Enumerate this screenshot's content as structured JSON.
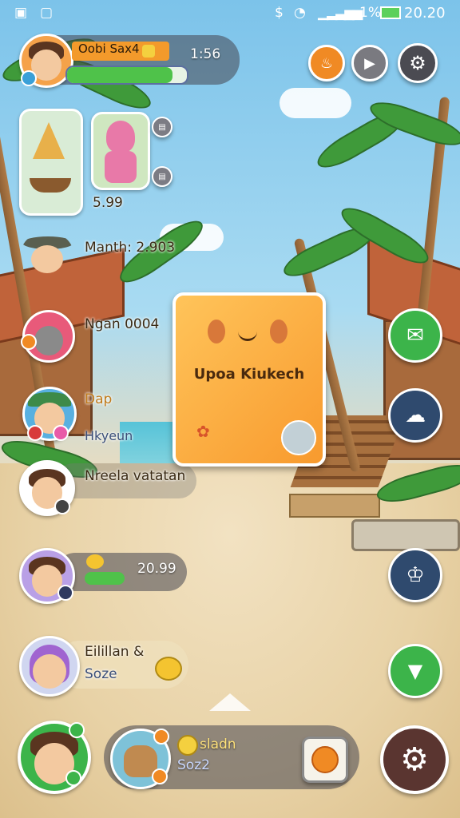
{
  "status_bar": {
    "time": "20.20",
    "battery": "1%"
  },
  "player": {
    "name": "Oobi Sax4",
    "timer": "1:56"
  },
  "side_list": {
    "item_value": "5.99",
    "entries": [
      {
        "label": "Manth: 2.903"
      },
      {
        "label": "Ngan 0004"
      },
      {
        "label": "Dap",
        "sublabel": "Hkyeun"
      },
      {
        "label": "Nreela vatatan"
      },
      {
        "value": "20.99"
      },
      {
        "label": "Eilillan &",
        "sublabel": "Soze"
      }
    ]
  },
  "center_card": {
    "title": "Upoa Kiukech"
  },
  "bottom_bar": {
    "label": "sladn",
    "sublabel": "Soz2"
  },
  "colors": {
    "accent_orange": "#f89a2e",
    "progress_green": "#4fc24a",
    "button_green": "#3cb44a",
    "button_navy": "#2f4a6e"
  },
  "icons": {
    "top_right": [
      "fire-icon",
      "play-icon",
      "gear-icon"
    ],
    "right_column": [
      "chat-plus-icon",
      "message-icon",
      "crown-icon",
      "download-arrow-icon"
    ],
    "bottom": [
      "settings-gear-icon",
      "caret-up-icon"
    ]
  }
}
